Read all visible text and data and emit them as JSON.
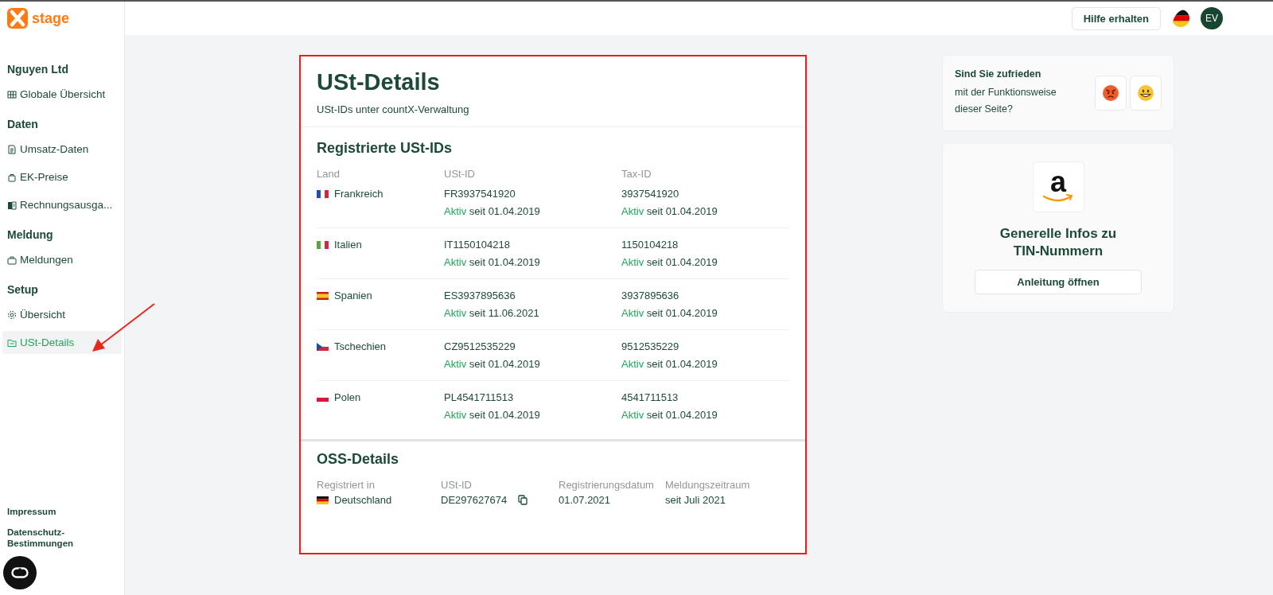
{
  "brand": {
    "name": "stage"
  },
  "sidebar": {
    "sections": [
      {
        "title": "Nguyen Ltd",
        "items": [
          {
            "label": "Globale Übersicht",
            "selected": false
          }
        ]
      },
      {
        "title": "Daten",
        "items": [
          {
            "label": "Umsatz-Daten",
            "selected": false
          },
          {
            "label": "EK-Preise",
            "selected": false
          },
          {
            "label": "Rechnungsausga...",
            "selected": false
          }
        ]
      },
      {
        "title": "Meldung",
        "items": [
          {
            "label": "Meldungen",
            "selected": false
          }
        ]
      },
      {
        "title": "Setup",
        "items": [
          {
            "label": "Übersicht",
            "selected": false
          },
          {
            "label": "USt-Details",
            "selected": true
          }
        ]
      }
    ],
    "footer_links": [
      "Impressum",
      "Datenschutz-Bestimmungen"
    ]
  },
  "topbar": {
    "help_button": "Hilfe erhalten",
    "avatar": "EV"
  },
  "card": {
    "title": "USt-Details",
    "subtitle": "USt-IDs unter countX-Verwaltung",
    "registered": {
      "heading": "Registrierte USt-IDs",
      "columns": [
        "Land",
        "USt-ID",
        "Tax-ID"
      ],
      "rows": [
        {
          "country": "Frankreich",
          "vat_id": "FR3937541920",
          "vat_status": "Aktiv",
          "vat_since": "seit 01.04.2019",
          "tax_id": "3937541920",
          "tax_status": "Aktiv",
          "tax_since": "seit 01.04.2019"
        },
        {
          "country": "Italien",
          "vat_id": "IT1150104218",
          "vat_status": "Aktiv",
          "vat_since": "seit 01.04.2019",
          "tax_id": "1150104218",
          "tax_status": "Aktiv",
          "tax_since": "seit 01.04.2019"
        },
        {
          "country": "Spanien",
          "vat_id": "ES3937895636",
          "vat_status": "Aktiv",
          "vat_since": "seit 11.06.2021",
          "tax_id": "3937895636",
          "tax_status": "Aktiv",
          "tax_since": "seit 01.04.2019"
        },
        {
          "country": "Tschechien",
          "vat_id": "CZ9512535229",
          "vat_status": "Aktiv",
          "vat_since": "seit 01.04.2019",
          "tax_id": "9512535229",
          "tax_status": "Aktiv",
          "tax_since": "seit 01.04.2019"
        },
        {
          "country": "Polen",
          "vat_id": "PL4541711513",
          "vat_status": "Aktiv",
          "vat_since": "seit 01.04.2019",
          "tax_id": "4541711513",
          "tax_status": "Aktiv",
          "tax_since": "seit 01.04.2019"
        }
      ]
    },
    "oss": {
      "heading": "OSS-Details",
      "columns": [
        "Registriert in",
        "USt-ID",
        "Registrierungsdatum",
        "Meldungszeitraum"
      ],
      "row": {
        "country": "Deutschland",
        "vat_id": "DE297627674",
        "date": "01.07.2021",
        "period": "seit Juli 2021"
      }
    }
  },
  "feedback": {
    "question": "Sind Sie zufrieden",
    "question_rest": "mit der Funktionsweise dieser Seite?",
    "options": [
      {
        "kind": "angry"
      },
      {
        "kind": "happy"
      }
    ]
  },
  "info": {
    "logo_letter": "a",
    "title": "Generelle Infos zu TIN-Nummern",
    "button": "Anleitung öffnen"
  }
}
